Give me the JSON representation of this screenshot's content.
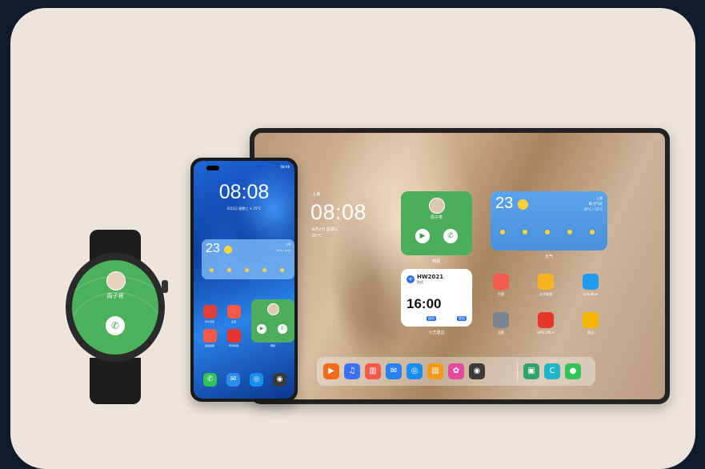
{
  "tablet": {
    "city": "上海",
    "time": "08:08",
    "date": "6月2日 星期三",
    "temp_short": "25°C",
    "contact_widget": {
      "name": "周子将",
      "label": "畅联"
    },
    "weather_widget": {
      "temp": "23",
      "city": "上海",
      "desc": "晴 空气优",
      "range": "26°C / 15°C",
      "label": "天气"
    },
    "meeting_widget": {
      "title": "HW2021",
      "sub": "航班",
      "time": "16:00",
      "label": "小艺建议",
      "tag1": "值机",
      "tag2": "登机"
    },
    "apps": [
      {
        "name": "主题",
        "color": "#f35a4a"
      },
      {
        "name": "文件管理",
        "color": "#f7b51c"
      },
      {
        "name": "Link Now",
        "color": "#1f9aef"
      },
      {
        "name": "设置",
        "color": "#7a8493"
      },
      {
        "name": "WPS Office",
        "color": "#e5352d"
      },
      {
        "name": "备忘",
        "color": "#f5b400"
      }
    ],
    "dock": [
      {
        "name": "video",
        "color": "#f26b1d",
        "glyph": "▶"
      },
      {
        "name": "music",
        "color": "#3b71f0",
        "glyph": "♫"
      },
      {
        "name": "books",
        "color": "#f3584a",
        "glyph": "▥"
      },
      {
        "name": "mail",
        "color": "#2a7ff4",
        "glyph": "✉"
      },
      {
        "name": "browser",
        "color": "#1a8df2",
        "glyph": "◎"
      },
      {
        "name": "office",
        "color": "#f49a1a",
        "glyph": "▤"
      },
      {
        "name": "gallery",
        "color": "#e64aa0",
        "glyph": "✿"
      },
      {
        "name": "camera",
        "color": "#3a3a3a",
        "glyph": "◉"
      },
      {
        "name": "screen",
        "color": "#2ea36b",
        "glyph": "▣"
      },
      {
        "name": "canva",
        "color": "#1fb6c8",
        "glyph": "C"
      },
      {
        "name": "chat",
        "color": "#33c25a",
        "glyph": "●"
      }
    ]
  },
  "phone": {
    "status": "08:08",
    "time": "08:08",
    "date": "6月2日 星期三 ☀ 25°C",
    "weather": {
      "temp": "23",
      "city": "上海",
      "range": "26°C / 15°C"
    },
    "apps": [
      {
        "name": "华为手机",
        "color": "#e0403a"
      },
      {
        "name": "主题",
        "color": "#f35a4a"
      },
      {
        "name": "运动健康",
        "color": "#f25a4a"
      },
      {
        "name": "华为商城",
        "color": "#e8342d"
      }
    ],
    "contact_label": "畅联",
    "dock": [
      {
        "name": "phone",
        "color": "#35c15c",
        "glyph": "✆"
      },
      {
        "name": "messages",
        "color": "#2d8cf0",
        "glyph": "✉"
      },
      {
        "name": "browser",
        "color": "#1a8df2",
        "glyph": "◎"
      },
      {
        "name": "camera",
        "color": "#3a3a3a",
        "glyph": "◉"
      }
    ]
  },
  "watch": {
    "name": "周子将"
  }
}
